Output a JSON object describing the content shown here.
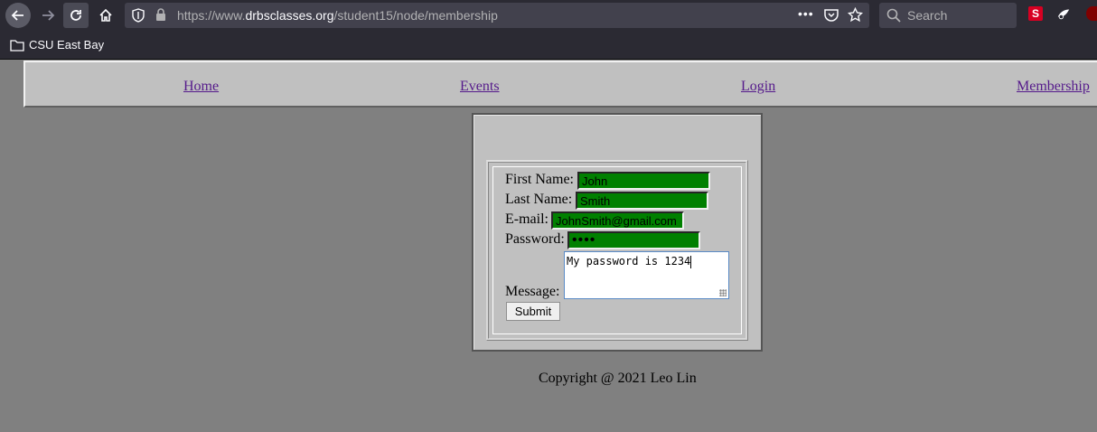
{
  "browser": {
    "url_prefix": "https://www.",
    "url_domain": "drbsclasses.org",
    "url_path": "/student15/node/membership",
    "search_placeholder": "Search",
    "more_actions": "•••",
    "extension_s_label": "S",
    "bookmarks": [
      {
        "label": "CSU East Bay"
      }
    ]
  },
  "nav": {
    "home": "Home",
    "events": "Events",
    "login": "Login",
    "membership": "Membership"
  },
  "form": {
    "first_name_label": "First Name:",
    "first_name_value": "John",
    "last_name_label": "Last Name:",
    "last_name_value": "Smith",
    "email_label": "E-mail:",
    "email_value": "JohnSmith@gmail.com",
    "password_label": "Password:",
    "password_value": "••••",
    "message_label": "Message:",
    "message_value": "My password is 1234",
    "submit_label": "Submit"
  },
  "footer": {
    "copyright": "Copyright @ 2021 Leo Lin"
  },
  "colors": {
    "input_bg": "#008000",
    "page_bg": "#808080",
    "nav_bg": "#c0c0c0",
    "link": "#551a8b"
  }
}
